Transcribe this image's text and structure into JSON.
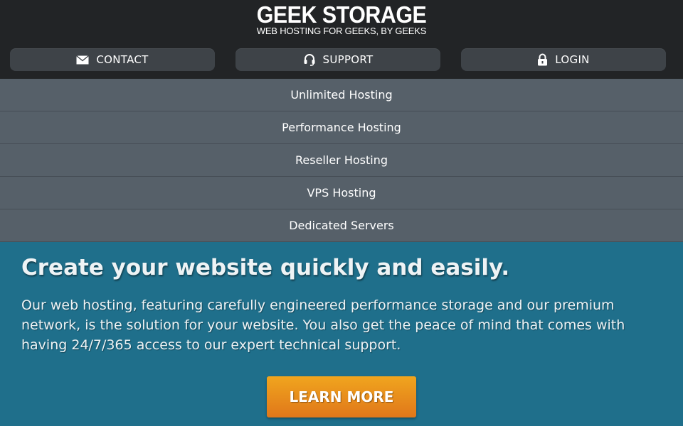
{
  "header": {
    "logo_title": "GEEK STORAGE",
    "logo_tagline": "WEB HOSTING FOR GEEKS, BY GEEKS",
    "buttons": [
      {
        "label": "CONTACT",
        "icon": "envelope-icon"
      },
      {
        "label": "SUPPORT",
        "icon": "headset-icon"
      },
      {
        "label": "LOGIN",
        "icon": "lock-icon"
      }
    ]
  },
  "nav": {
    "items": [
      {
        "label": "Unlimited Hosting"
      },
      {
        "label": "Performance Hosting"
      },
      {
        "label": "Reseller Hosting"
      },
      {
        "label": "VPS Hosting"
      },
      {
        "label": "Dedicated Servers"
      }
    ]
  },
  "hero": {
    "title": "Create your website quickly and easily.",
    "text": "Our web hosting, featuring carefully engineered performance storage and our premium network, is the solution for your website. You also get the peace of mind that comes with having 24/7/365 access to our expert technical support.",
    "button_label": "LEARN MORE"
  },
  "colors": {
    "header_bg": "#222426",
    "button_bg": "#3e4348",
    "nav_bg": "#566069",
    "hero_bg": "#1f6f8b",
    "cta_orange": "#e88a1c"
  }
}
